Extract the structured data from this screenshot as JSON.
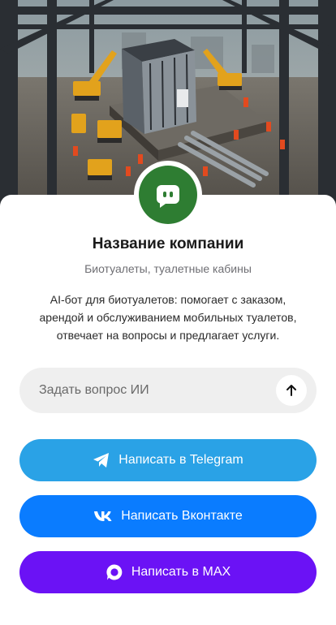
{
  "hero": {
    "icon": "construction-site-image"
  },
  "company": {
    "avatar_icon": "bot-chat-icon",
    "name": "Название компании",
    "category": "Биотуалеты, туалетные кабины",
    "description": "AI-бот для биотуалетов: помогает с заказом, арендой и обслуживанием мобильных туалетов, отвечает на вопросы и предлагает услуги."
  },
  "ask": {
    "placeholder": "Задать вопрос ИИ",
    "value": "",
    "send_icon": "arrow-up-icon"
  },
  "buttons": {
    "telegram": {
      "label": "Написать в Telegram",
      "icon": "telegram-icon",
      "color": "#2aa2e6"
    },
    "vk": {
      "label": "Написать Вконтакте",
      "icon": "vk-icon",
      "color": "#0a7cff"
    },
    "max": {
      "label": "Написать в MAX",
      "icon": "max-icon",
      "color": "#6b12f5"
    }
  },
  "colors": {
    "avatar_bg": "#2e7d32",
    "ask_bg": "#efefef"
  }
}
